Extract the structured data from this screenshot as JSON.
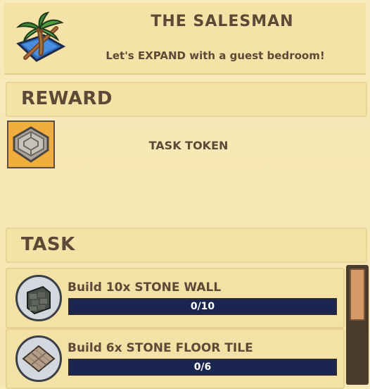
{
  "quest": {
    "title": "THE SALESMAN",
    "subtitle": "Let's EXPAND with a guest bedroom!",
    "icon": "palm-tree-island-icon"
  },
  "reward": {
    "section_label": "REWARD",
    "items": [
      {
        "label": "TASK TOKEN",
        "icon": "task-token-icon"
      }
    ]
  },
  "task": {
    "section_label": "TASK",
    "items": [
      {
        "text": "Build 10x STONE WALL",
        "progress": "0/10",
        "done": 0,
        "total": 10,
        "icon": "stone-wall-icon"
      },
      {
        "text": "Build 6x STONE FLOOR TILE",
        "progress": "0/6",
        "done": 0,
        "total": 6,
        "icon": "stone-floor-tile-icon"
      }
    ]
  },
  "colors": {
    "panel_bg": "#f7e9b6",
    "progress_bg": "#1a2550",
    "token_slot_bg": "#f1ad3e",
    "text": "#5c4a36"
  }
}
